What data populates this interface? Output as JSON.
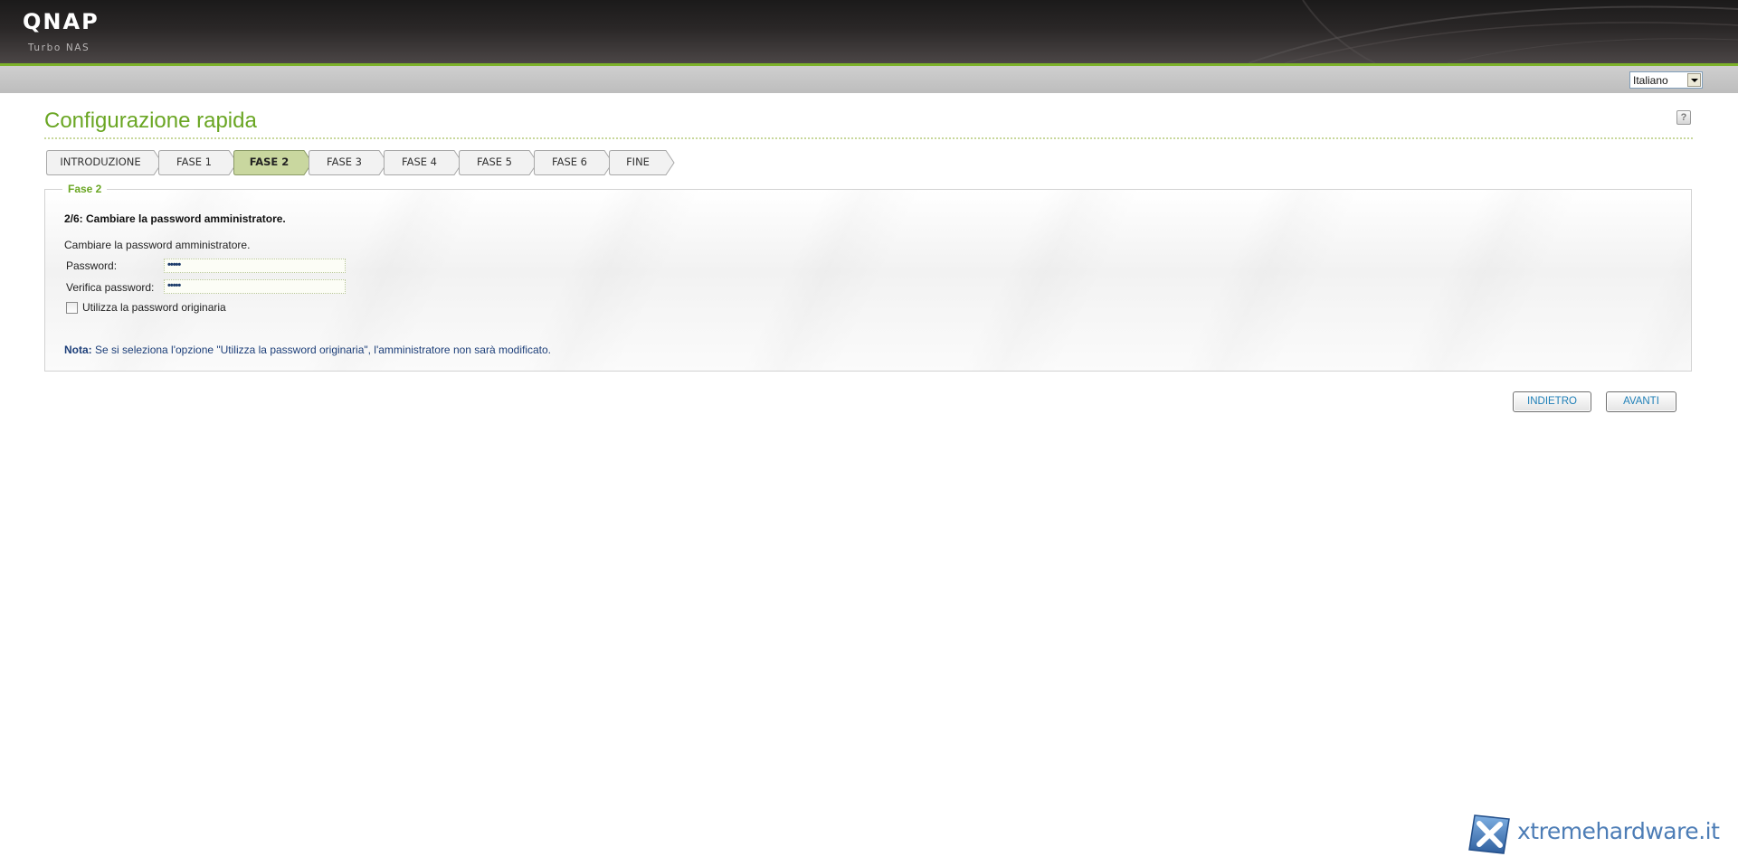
{
  "header": {
    "logo": "QNAP",
    "logo_sub": "Turbo NAS"
  },
  "language": {
    "selected": "Italiano"
  },
  "page": {
    "title": "Configurazione rapida",
    "help_icon": "?"
  },
  "steps": [
    {
      "label": "INTRODUZIONE",
      "active": false
    },
    {
      "label": "FASE 1",
      "active": false
    },
    {
      "label": "FASE 2",
      "active": true
    },
    {
      "label": "FASE 3",
      "active": false
    },
    {
      "label": "FASE 4",
      "active": false
    },
    {
      "label": "FASE 5",
      "active": false
    },
    {
      "label": "FASE 6",
      "active": false
    },
    {
      "label": "FINE",
      "active": false
    }
  ],
  "form": {
    "legend": "Fase 2",
    "heading": "2/6: Cambiare la password amministratore.",
    "description": "Cambiare la password amministratore.",
    "password_label": "Password:",
    "password_value": "•••••",
    "verify_label": "Verifica password:",
    "verify_value": "•••••",
    "checkbox_label": "Utilizza la password originaria",
    "checkbox_checked": false,
    "note_tag": "Nota:",
    "note_text": " Se si seleziona l'opzione \"Utilizza la password originaria\", l'amministratore non sarà modificato."
  },
  "buttons": {
    "back": "INDIETRO",
    "next": "AVANTI"
  },
  "watermark": {
    "text": "xtremehardware.it"
  },
  "colors": {
    "accent_green": "#6aa623",
    "active_step": "#c9d79f",
    "button_text": "#1e7fb7",
    "note_text": "#1d3f79"
  }
}
